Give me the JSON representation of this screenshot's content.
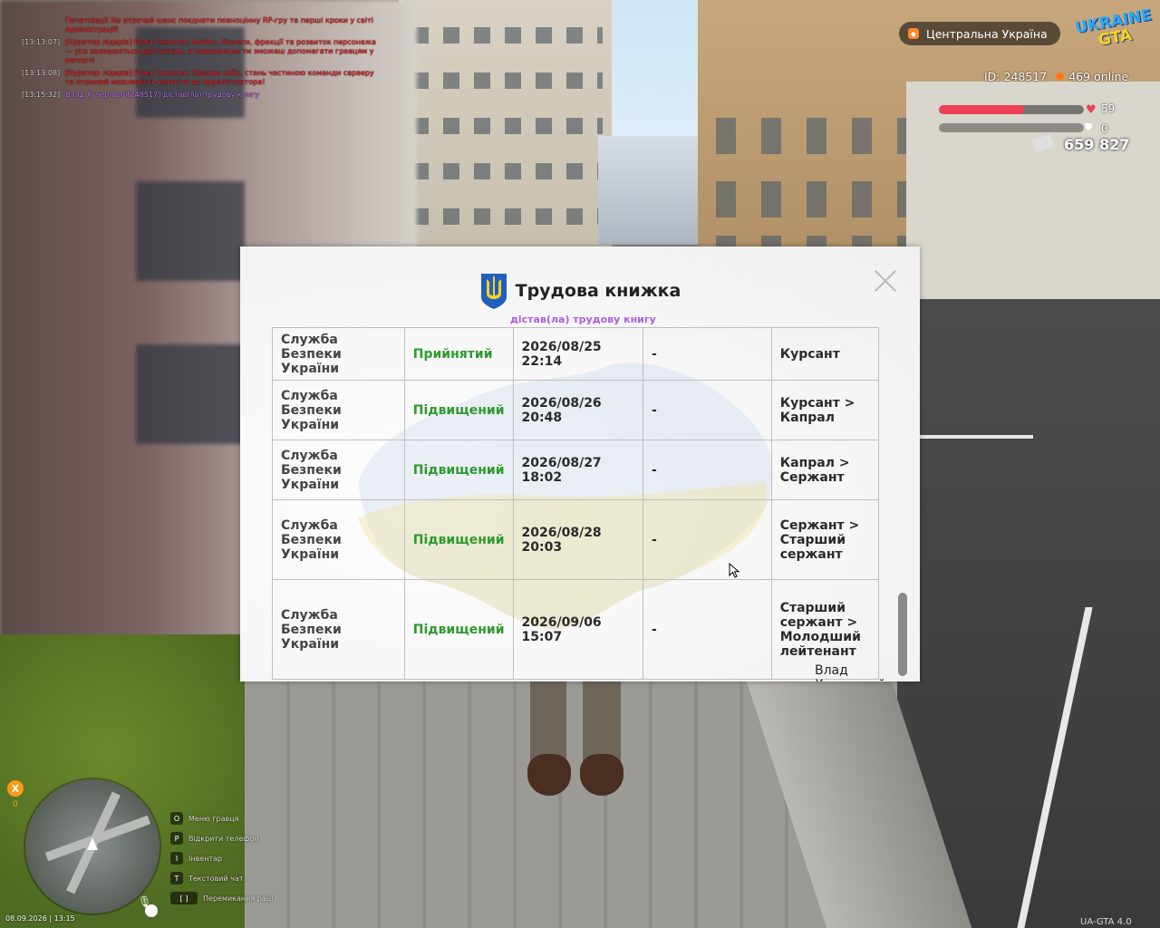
{
  "chat": [
    {
      "time": "",
      "text": "Початківці! Не втрачай шанс поєднати повноцінну RP-гру та перші кроки у світі Адміністрації!",
      "color": "red"
    },
    {
      "time": "[13:13:07]",
      "text": "[Куратор лідерів] Рома Семеген: Майно, бізнеси, фракції та розвиток персонажа — усе залишається доступним, а паралельно ти зможеш допомагати гравцям у репорті",
      "color": "red"
    },
    {
      "time": "[13:13:08]",
      "text": "[Куратор лідерів] Рома Семеген: Прояви себе, стань частиною команди серверу та отримай можливість вирости до Адміністратора!",
      "color": "red"
    },
    {
      "time": "[13:15:32]",
      "text": "Влад Хучерявий[248517] дістав(ла) трудову книгу",
      "color": "purple"
    }
  ],
  "hud": {
    "region": "Центральна Україна",
    "logo_top": "UKRAINE",
    "logo_bottom": "GTA",
    "player_id": "ID: 248517",
    "online": "469 online",
    "health": "59",
    "health_fraction": 0.59,
    "armor": "0",
    "money": "659 827",
    "x_badge": "X",
    "x_count": "0",
    "datetime": "08.09.2026 | 13:15",
    "version": "UA-GTA 4.0"
  },
  "hotkeys": [
    {
      "key": "O",
      "label": "Меню гравця"
    },
    {
      "key": "P",
      "label": "Відкрити телефон"
    },
    {
      "key": "I",
      "label": "Інвентар"
    },
    {
      "key": "T",
      "label": "Текстовий чат"
    },
    {
      "key": "[ ]",
      "label": "Перемикання раці"
    }
  ],
  "modal": {
    "title": "Трудова книжка",
    "bleed_text": "дістав(ла) трудову книгу",
    "footer_name": "Влад Хучерявий",
    "rows": [
      {
        "org": "Служба Безпеки України",
        "status": "Прийнятий",
        "date": "2026/08/25 22:14",
        "note": "-",
        "rank": "Курсант"
      },
      {
        "org": "Служба Безпеки України",
        "status": "Підвищений",
        "date": "2026/08/26 20:48",
        "note": "-",
        "rank": "Курсант > Капрал"
      },
      {
        "org": "Служба Безпеки України",
        "status": "Підвищений",
        "date": "2026/08/27 18:02",
        "note": "-",
        "rank": "Капрал > Сержант"
      },
      {
        "org": "Служба Безпеки України",
        "status": "Підвищений",
        "date": "2026/08/28 20:03",
        "note": "-",
        "rank": "Сержант > Старший сержант"
      },
      {
        "org": "Служба Безпеки України",
        "status": "Підвищений",
        "date": "2026/09/06 15:07",
        "note": "-",
        "rank": "Старший сержант > Молодший лейтенант"
      }
    ]
  },
  "colors": {
    "status_green": "#2e9a2e",
    "chat_red": "#ff2a2a",
    "chat_purple": "#c57cff",
    "health": "#ee4055",
    "accent_orange": "#ff8a2a"
  }
}
